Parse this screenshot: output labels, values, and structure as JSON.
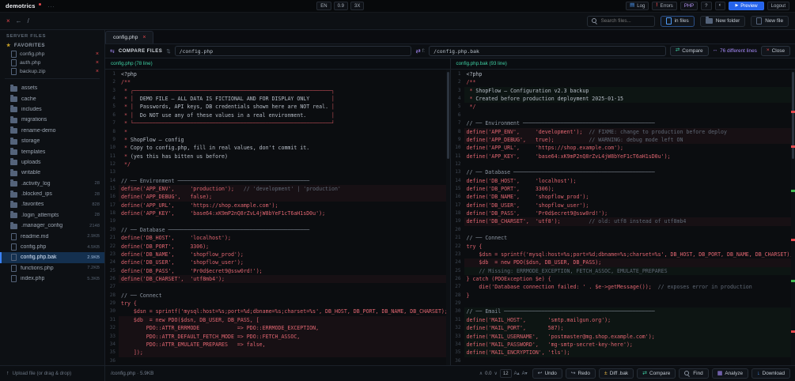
{
  "colors": {
    "accent": "#3b82f6",
    "danger": "#e5484d",
    "purple": "#a78bfa",
    "green": "#3fd0a4",
    "code_red": "#e06570"
  },
  "topbar": {
    "logo": "demotrics",
    "menu_dots": "...",
    "chips": [
      "EN",
      "0.9",
      "3X"
    ],
    "log_label": "Log",
    "errors_label": "Errors",
    "php_label": "PHP",
    "help_label": "?",
    "preview_label": "Preview",
    "logout_label": "Logout"
  },
  "toolbar": {
    "search_placeholder": "Search files...",
    "in_files_label": "in files",
    "new_folder_label": "New folder",
    "new_file_label": "New file"
  },
  "tab": {
    "label": "config.php"
  },
  "sidebar": {
    "server_files_label": "SERVER FILES",
    "favorites_label": "FAVORITES",
    "favorites": [
      {
        "name": "config.php"
      },
      {
        "name": "auth.php"
      },
      {
        "name": "backup.zip"
      }
    ],
    "tree": [
      {
        "name": "assets",
        "folder": true
      },
      {
        "name": "cache",
        "folder": true
      },
      {
        "name": "includes",
        "folder": true
      },
      {
        "name": "migrations",
        "folder": true
      },
      {
        "name": "rename-demo",
        "folder": true
      },
      {
        "name": "storage",
        "folder": true
      },
      {
        "name": "templates",
        "folder": true
      },
      {
        "name": "uploads",
        "folder": true
      },
      {
        "name": "writable",
        "folder": true
      },
      {
        "name": ".activity_log",
        "folder": true,
        "badge": "28"
      },
      {
        "name": ".blocked_ips",
        "folder": true,
        "badge": "28"
      },
      {
        "name": ".favorites",
        "folder": true,
        "badge": "828"
      },
      {
        "name": ".login_attempts",
        "folder": true,
        "badge": "28"
      },
      {
        "name": ".manager_config",
        "folder": true,
        "badge": "2148"
      },
      {
        "name": "readme.md",
        "badge": "2.9KB"
      },
      {
        "name": "config.php",
        "badge": "4.5KB"
      },
      {
        "name": "config.php.bak",
        "badge": "2.9KB",
        "selected": true
      },
      {
        "name": "functions.php",
        "badge": "7.2KB"
      },
      {
        "name": "index.php",
        "badge": "5.3KB"
      }
    ]
  },
  "compare": {
    "label": "COMPARE FILES",
    "left_path": "/config.php",
    "right_path": "/config.php.bak",
    "with_label": "f:",
    "compare_button": "Compare",
    "diff_label": "76 different lines",
    "close_button": "Close"
  },
  "panes": {
    "left": {
      "title": "config.php (78 line)",
      "changed": [
        15,
        16,
        26,
        31,
        32,
        33,
        34,
        35
      ],
      "added": [],
      "lines": [
        "<?php",
        "/**",
        " * ┌───────────────────────────────────────────────────────────────┐",
        " * │  DEMO FILE — ALL DATA IS FICTIONAL AND FOR DISPLAY ONLY       │",
        " * │  Passwords, API keys, DB credentials shown here are NOT real. │",
        " * │  Do NOT use any of these values in a real environment.        │",
        " * └───────────────────────────────────────────────────────────────┘",
        " *",
        " * ShopFlow — config",
        " * Copy to config.php, fill in real values, don't commit it.",
        " * (yes this has bitten us before)",
        " */",
        "",
        "// ── Environment ──────────────────────────────────────────",
        "define('APP_ENV',     'production');   // 'development' | 'production'",
        "define('APP_DEBUG',   false);",
        "define('APP_URL',     'https://shop.example.com');",
        "define('APP_KEY',     'base64:xK9mP2nQ8rZvL4jW8bYeF1cT6aH1sD0u');",
        "",
        "// ── Database ─────────────────────────────────────────────",
        "define('DB_HOST',     'localhost');",
        "define('DB_PORT',     3306);",
        "define('DB_NAME',     'shopflow_prod');",
        "define('DB_USER',     'shopflow_user');",
        "define('DB_PASS',     'Pr0d$ecret9@ssw0rd!');",
        "define('DB_CHARSET',  'utf8mb4');",
        "",
        "// ── Connect",
        "try {",
        "    $dsn = sprintf('mysql:host=%s;port=%d;dbname=%s;charset=%s', DB_HOST, DB_PORT, DB_NAME, DB_CHARSET);",
        "    $db  = new PDO($dsn, DB_USER, DB_PASS, [",
        "        PDO::ATTR_ERRMODE            => PDO::ERRMODE_EXCEPTION,",
        "        PDO::ATTR_DEFAULT_FETCH_MODE => PDO::FETCH_ASSOC,",
        "        PDO::ATTR_EMULATE_PREPARES   => false,",
        "    ]);",
        ""
      ]
    },
    "right": {
      "title": "config.php.bak (93 line)",
      "changed": [
        8,
        9,
        19,
        24
      ],
      "added": [
        3,
        4,
        25,
        30,
        31,
        32,
        33,
        34,
        35
      ],
      "lines": [
        "<?php",
        "/**",
        " * ShopFlow — Configuration v2.3 backup",
        " * Created before production deployment 2025-01-15",
        " */",
        "",
        "// ── Environment ──────────────────────────────────────────",
        "define('APP_ENV',     'development');  // FIXME: change to production before deploy",
        "define('APP_DEBUG',   true);           // WARNING: debug mode left ON",
        "define('APP_URL',     'https://shop.example.com');",
        "define('APP_KEY',     'base64:xK9mP2nQ8rZvL4jW8bYeF1cT6aH1sD0u');",
        "",
        "// ── Database ─────────────────────────────────────────────",
        "define('DB_HOST',     'localhost');",
        "define('DB_PORT',     3306);",
        "define('DB_NAME',     'shopflow_prod');",
        "define('DB_USER',     'shopflow_user');",
        "define('DB_PASS',     'Pr0d$ecret9@ssw0rd!');",
        "define('DB_CHARSET',  'utf8');         // old: utf8 instead of utf8mb4",
        "",
        "// ── Connect",
        "try {",
        "    $dsn = sprintf('mysql:host=%s;port=%d;dbname=%s;charset=%s', DB_HOST, DB_PORT, DB_NAME, DB_CHARSET);",
        "    $db  = new PDO($dsn, DB_USER, DB_PASS);",
        "    // Missing: ERRMODE_EXCEPTION, FETCH_ASSOC, EMULATE_PREPARES",
        "} catch (PDOException $e) {",
        "    die('Database connection failed: ' . $e->getMessage());  // exposes error in production",
        "}",
        "",
        "// ── Email ────────────────────────────────────────────────",
        "define('MAIL_HOST',       'smtp.mailgun.org');",
        "define('MAIL_PORT',       587);",
        "define('MAIL_USERNAME',   'postmaster@mg.shop.example.com');",
        "define('MAIL_PASSWORD',   'mg-smtp-secret-key-here');",
        "define('MAIL_ENCRYPTION', 'tls');",
        ""
      ]
    }
  },
  "statusbar": {
    "upload_label": "Upload file (or drag & drop)",
    "file_info": "/config.php · 5.9KB",
    "scroll_value": "0.0",
    "font_size": "12",
    "buttons": [
      {
        "icon": "↩",
        "label": "Undo"
      },
      {
        "icon": "↪",
        "label": "Redo"
      },
      {
        "icon": "±",
        "label": "Diff .bak"
      },
      {
        "icon": "⇄",
        "label": "Compare"
      },
      {
        "icon": "",
        "label": "Find",
        "find": true
      },
      {
        "icon": "▦",
        "label": "Analyze"
      },
      {
        "icon": "↓",
        "label": "Download"
      }
    ]
  }
}
